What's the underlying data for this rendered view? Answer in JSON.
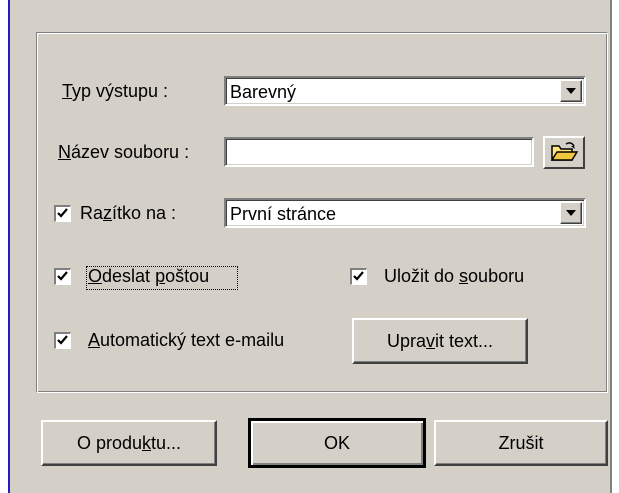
{
  "fields": {
    "output_type": {
      "label_mnemonic": "T",
      "label_rest": "yp výstupu :",
      "value": "Barevný"
    },
    "file_name": {
      "label_mnemonic": "N",
      "label_rest": "ázev souboru :",
      "value": ""
    },
    "stamp": {
      "label_pre": "Ra",
      "label_mnemonic": "z",
      "label_post": "ítko na :",
      "checked": true,
      "value": "První stránce"
    }
  },
  "checks": {
    "send_mail": {
      "label_pre": "",
      "label_mnemonic": "O",
      "label_mid": "deslat ",
      "label_mnemonic2": "p",
      "label_post": "oštou",
      "checked": true
    },
    "save_file": {
      "label_pre": "Uložit do ",
      "label_mnemonic": "s",
      "label_post": "ouboru",
      "checked": true
    },
    "auto_text": {
      "label_mnemonic": "A",
      "label_post": "utomatický text e-mailu",
      "checked": true
    }
  },
  "buttons": {
    "edit_text": {
      "pre": "Upra",
      "mnemonic": "v",
      "post": "it text..."
    },
    "about": {
      "pre": "O produ",
      "mnemonic": "k",
      "post": "tu..."
    },
    "ok": {
      "label": "OK"
    },
    "cancel": {
      "label": "Zrušit"
    }
  },
  "icons": {
    "browse": "open-folder-icon",
    "dropdown": "chevron-down-icon",
    "check": "checkmark-icon"
  }
}
